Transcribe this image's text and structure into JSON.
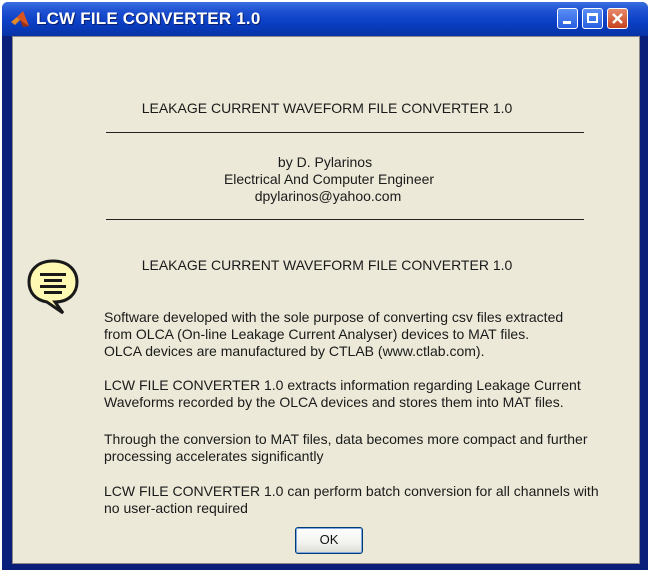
{
  "window": {
    "title": "LCW FILE CONVERTER 1.0",
    "colors": {
      "titlebar": "#0a3ec4",
      "client": "#ece9d8",
      "close_button": "#c5421e"
    }
  },
  "content": {
    "heading1": "LEAKAGE CURRENT WAVEFORM FILE CONVERTER 1.0",
    "author": {
      "by_line": "by   D. Pylarinos",
      "role": "Electrical And Computer Engineer",
      "email": "dpylarinos@yahoo.com"
    },
    "heading2": "LEAKAGE CURRENT WAVEFORM FILE CONVERTER 1.0",
    "paragraphs": [
      [
        "Software developed with the sole purpose of converting csv files extracted",
        "from OLCA (On-line Leakage Current Analyser) devices to MAT files.",
        "OLCA devices are manufactured by CTLAB (www.ctlab.com)."
      ],
      [
        "LCW FILE CONVERTER 1.0 extracts information regarding Leakage Current",
        "Waveforms recorded by the OLCA devices and stores them into MAT files."
      ],
      [
        "Through the conversion to MAT files, data becomes more compact and further",
        "processing accelerates significantly"
      ],
      [
        "LCW FILE CONVERTER 1.0 can perform batch conversion for all channels with",
        "no user-action required"
      ]
    ],
    "info_icon": "speech-bubble-info-icon"
  },
  "buttons": {
    "ok": "OK"
  }
}
